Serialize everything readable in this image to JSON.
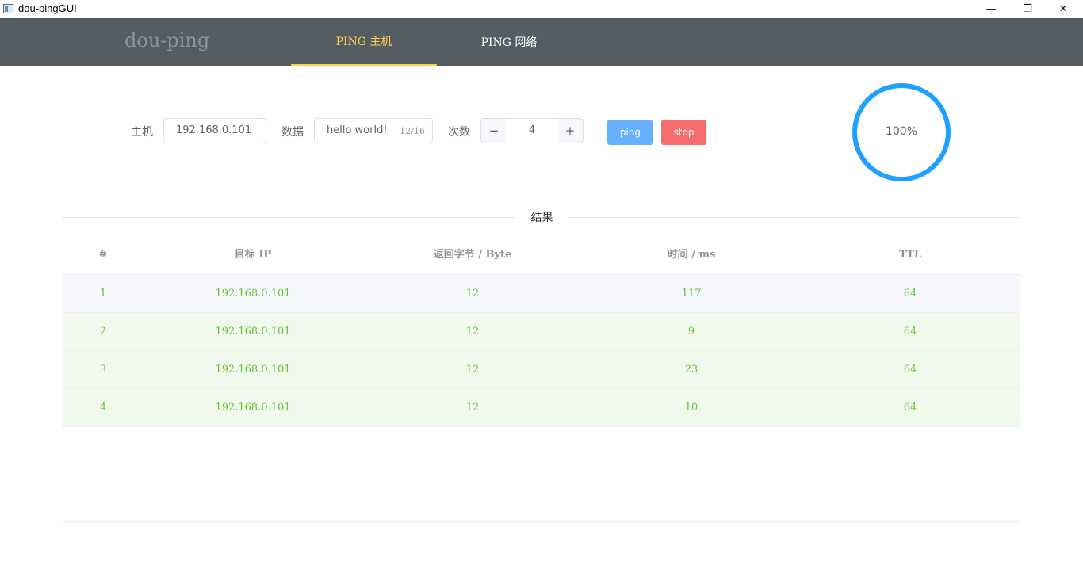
{
  "window": {
    "title": "dou-pingGUI",
    "controls": {
      "minimize": "—",
      "maximize": "❐",
      "close": "✕"
    }
  },
  "nav": {
    "brand": "dou-ping",
    "tabs": [
      {
        "label": "PING 主机",
        "active": true
      },
      {
        "label": "PING 网络",
        "active": false
      }
    ],
    "colors": {
      "background": "#545c64",
      "active": "#ffd04b"
    }
  },
  "form": {
    "host_label": "主机",
    "host_value": "192.168.0.101",
    "data_label": "数据",
    "data_value": "hello world!",
    "data_count": "12/16",
    "times_label": "次数",
    "times_value": "4",
    "minus": "−",
    "plus": "+",
    "ping_label": "ping",
    "stop_label": "stop"
  },
  "progress": {
    "percent": 100,
    "text": "100%",
    "color": "#20a0ff"
  },
  "results": {
    "divider_label": "结果",
    "columns": [
      "#",
      "目标 IP",
      "返回字节 / Byte",
      "时间 / ms",
      "TTL"
    ],
    "rows": [
      [
        "1",
        "192.168.0.101",
        "12",
        "117",
        "64"
      ],
      [
        "2",
        "192.168.0.101",
        "12",
        "9",
        "64"
      ],
      [
        "3",
        "192.168.0.101",
        "12",
        "23",
        "64"
      ],
      [
        "4",
        "192.168.0.101",
        "12",
        "10",
        "64"
      ]
    ],
    "success_color": "#67c23a"
  }
}
